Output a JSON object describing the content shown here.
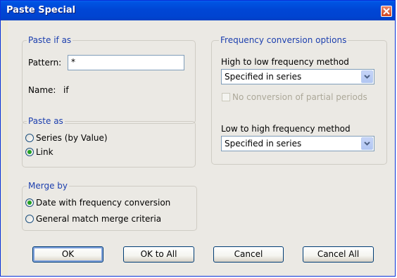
{
  "window": {
    "title": "Paste Special"
  },
  "paste_if_as": {
    "legend": "Paste if as",
    "pattern_label": "Pattern:",
    "pattern_value": "*",
    "name_label": "Name:",
    "name_value": "if"
  },
  "paste_as": {
    "legend": "Paste as",
    "options": [
      {
        "label": "Series (by Value)",
        "selected": false
      },
      {
        "label": "Link",
        "selected": true
      }
    ]
  },
  "merge_by": {
    "legend": "Merge by",
    "options": [
      {
        "label": "Date with frequency conversion",
        "selected": true
      },
      {
        "label": "General match merge criteria",
        "selected": false
      }
    ]
  },
  "frequency": {
    "legend": "Frequency conversion options",
    "high_to_low_label": "High to low frequency method",
    "high_to_low_value": "Specified in series",
    "no_partial_label": "No conversion of partial periods",
    "low_to_high_label": "Low to high frequency method",
    "low_to_high_value": "Specified in series"
  },
  "buttons": {
    "ok": "OK",
    "ok_all": "OK to All",
    "cancel": "Cancel",
    "cancel_all": "Cancel All"
  }
}
